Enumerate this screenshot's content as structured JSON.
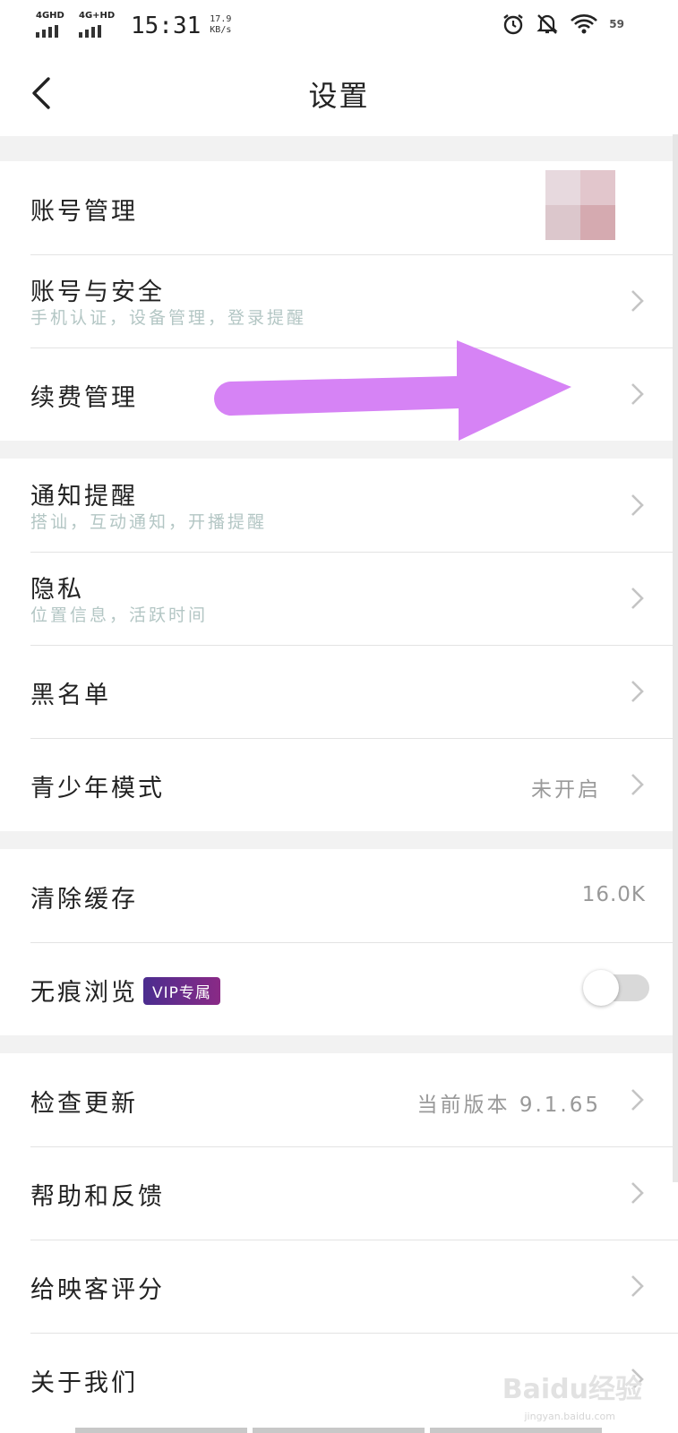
{
  "status_bar": {
    "signal1_tag": "4GHD",
    "signal2_tag": "4G+HD",
    "time": "15:31",
    "speed_value": "17.9",
    "speed_unit": "KB/s",
    "battery": "59"
  },
  "header": {
    "title": "设置"
  },
  "sections": [
    {
      "items": [
        {
          "title": "账号管理",
          "subtitle": "",
          "value": ""
        },
        {
          "title": "账号与安全",
          "subtitle": "手机认证，设备管理，登录提醒",
          "value": ""
        },
        {
          "title": "续费管理",
          "subtitle": "",
          "value": ""
        }
      ]
    },
    {
      "items": [
        {
          "title": "通知提醒",
          "subtitle": "搭讪，互动通知，开播提醒",
          "value": ""
        },
        {
          "title": "隐私",
          "subtitle": "位置信息，活跃时间",
          "value": ""
        },
        {
          "title": "黑名单",
          "subtitle": "",
          "value": ""
        },
        {
          "title": "青少年模式",
          "subtitle": "",
          "value": "未开启"
        }
      ]
    },
    {
      "items": [
        {
          "title": "清除缓存",
          "subtitle": "",
          "value": "16.0K"
        },
        {
          "title": "无痕浏览",
          "badge": "VIP专属",
          "toggle_on": false
        }
      ]
    },
    {
      "items": [
        {
          "title": "检查更新",
          "subtitle": "",
          "value": "当前版本 9.1.65"
        },
        {
          "title": "帮助和反馈",
          "subtitle": "",
          "value": ""
        },
        {
          "title": "给映客评分",
          "subtitle": "",
          "value": ""
        },
        {
          "title": "关于我们",
          "subtitle": "",
          "value": ""
        }
      ]
    }
  ],
  "annotation": {
    "arrow_color": "#d683f5"
  },
  "watermark": {
    "logo": "Baidu经验",
    "url": "jingyan.baidu.com"
  },
  "colors": {
    "vip_badge_start": "#4b2d8f",
    "vip_badge_end": "#8a2a86",
    "subtitle": "#b3c6c4"
  }
}
